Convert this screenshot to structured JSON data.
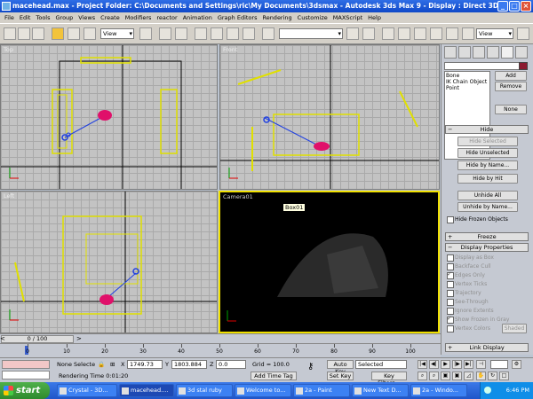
{
  "window": {
    "title": "macehead.max  - Project Folder: C:\\Documents and Settings\\ric\\My Documents\\3dsmax   - Autodesk 3ds Max 9     - Display : Direct 3D"
  },
  "menu": [
    "File",
    "Edit",
    "Tools",
    "Group",
    "Views",
    "Create",
    "Modifiers",
    "reactor",
    "Animation",
    "Graph Editors",
    "Rendering",
    "Customize",
    "MAXScript",
    "Help"
  ],
  "toolbar": {
    "ref_coord": "View",
    "selection_set": "",
    "view_dropdown": "View"
  },
  "viewports": {
    "top": "Top",
    "front": "Front",
    "left": "Left",
    "camera": "Camera01",
    "camera_tooltip": "Box01"
  },
  "command_panel": {
    "list_items": [
      "Bone",
      "IK Chain Object",
      "Point"
    ],
    "add": "Add",
    "remove": "Remove",
    "none": "None",
    "hide_rollout": "Hide",
    "hide_selected": "Hide Selected",
    "hide_unselected": "Hide Unselected",
    "hide_by_name": "Hide by Name...",
    "hide_by_hit": "Hide by Hit",
    "unhide_all": "Unhide All",
    "unhide_by_name": "Unhide by Name...",
    "hide_frozen": "Hide Frozen Objects",
    "freeze_rollout": "Freeze",
    "display_props_rollout": "Display Properties",
    "display_as_box": "Display as Box",
    "backface_cull": "Backface Cull",
    "edges_only": "Edges Only",
    "vertex_ticks": "Vertex Ticks",
    "trajectory": "Trajectory",
    "see_through": "See-Through",
    "ignore_extents": "Ignore Extents",
    "show_frozen_gray": "Show Frozen in Gray",
    "vertex_colors": "Vertex Colors",
    "shaded": "Shaded",
    "link_display_rollout": "Link Display"
  },
  "timeline": {
    "frame": "0 / 100",
    "ticks": [
      "0",
      "10",
      "20",
      "30",
      "40",
      "50",
      "60",
      "70",
      "80",
      "90",
      "100"
    ]
  },
  "status": {
    "selection": "None Selecte",
    "x": "1749.73",
    "y": "1803.884",
    "z": "0.0",
    "grid": "Grid = 100.0",
    "rendering_time": "Rendering Time  0:01:20",
    "add_time_tag": "Add Time Tag",
    "auto_key": "Auto Key",
    "set_key": "Set Key",
    "key_mode": "Selected",
    "key_filters": "Key Filters..."
  },
  "taskbar": {
    "start": "start",
    "tasks": [
      "Crystal - 3D...",
      "macehead....",
      "3d stal ruby",
      "Welcome to...",
      "2a - Paint",
      "New Text D...",
      "2a - Windo..."
    ],
    "clock": "6:46 PM"
  },
  "colors": {
    "title_bar": "#0f48c8",
    "viewport_bg": "#c3c3c3",
    "camera_border": "#f0e000",
    "object_yellow": "#e0e000",
    "object_magenta": "#e0106a",
    "object_blue": "#2040e0",
    "taskbar": "#245edc",
    "start_green": "#3c9a3a"
  }
}
